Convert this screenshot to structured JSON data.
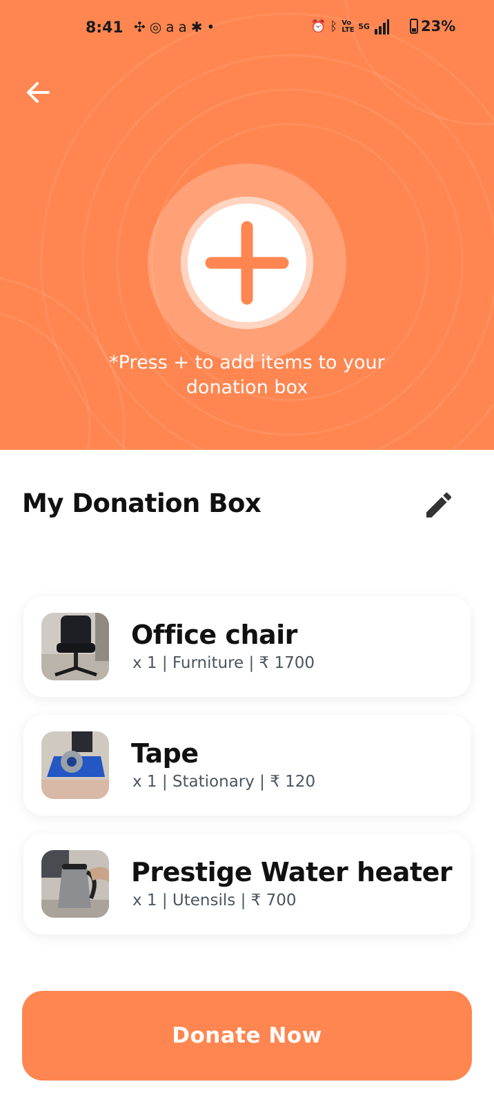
{
  "status_bar": {
    "time": "8:41",
    "battery": "23%",
    "network": "5G",
    "volte": "Vo LTE"
  },
  "hero": {
    "hint_line1": "*Press + to add items to your",
    "hint_line2": "donation box"
  },
  "section": {
    "title": "My Donation Box"
  },
  "items": [
    {
      "name": "Office chair",
      "meta": "x 1 | Furniture | ₹ 1700",
      "thumb": "office-chair-photo"
    },
    {
      "name": "Tape",
      "meta": "x 1 | Stationary | ₹ 120",
      "thumb": "tape-dispenser-photo"
    },
    {
      "name": "Prestige Water heater",
      "meta": "x 1 | Utensils | ₹ 700",
      "thumb": "kettle-photo"
    }
  ],
  "donate_label": "Donate Now",
  "colors": {
    "accent": "#FF8650",
    "text_primary": "#111111",
    "text_secondary": "#4a5560"
  }
}
